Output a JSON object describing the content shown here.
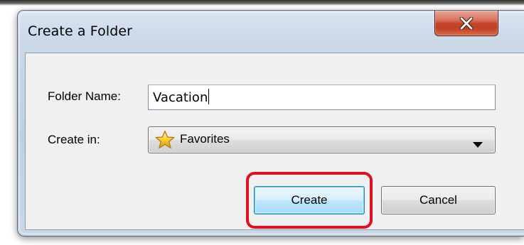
{
  "dialog": {
    "title": "Create a Folder",
    "close_icon": "close-x-icon",
    "close_button_color": "#c94a2f"
  },
  "form": {
    "folder_name_label": "Folder Name:",
    "folder_name_value": "Vacation",
    "create_in_label": "Create in:",
    "create_in_selected": "Favorites",
    "create_in_icon": "favorites-star-icon",
    "dropdown_icon": "dropdown-arrow-icon"
  },
  "buttons": {
    "create_label": "Create",
    "cancel_label": "Cancel"
  },
  "annotation": {
    "highlight_color": "#e0101e",
    "highlight_target": "create-button"
  }
}
